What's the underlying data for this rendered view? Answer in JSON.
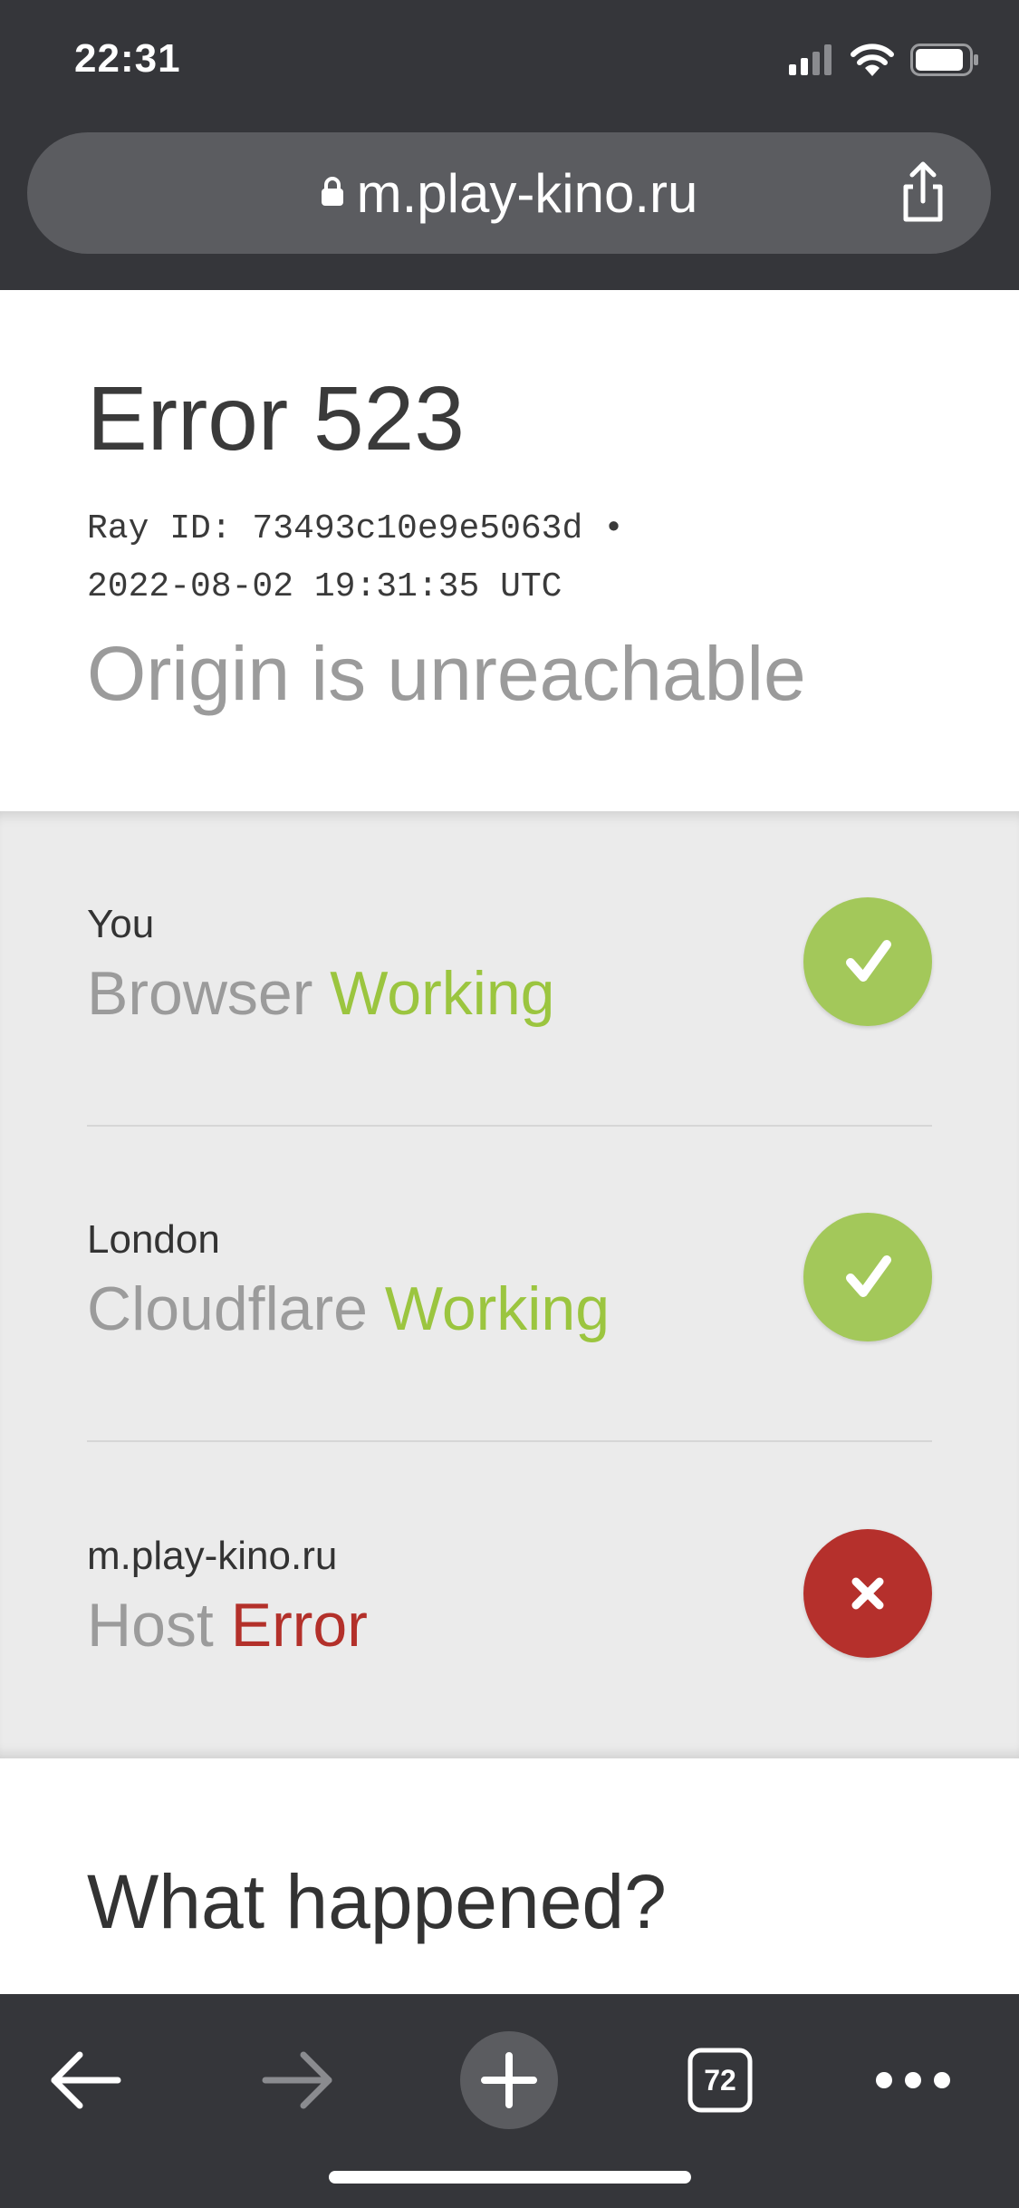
{
  "status_bar": {
    "time": "22:31"
  },
  "browser": {
    "url": "m.play-kino.ru",
    "tab_count": "72"
  },
  "page": {
    "title": "Error 523",
    "ray_line1": "Ray ID: 73493c10e9e5063d •",
    "ray_line2": "2022-08-02 19:31:35 UTC",
    "subtitle": "Origin is unreachable",
    "rows": [
      {
        "location": "You",
        "name": "Browser",
        "status": "Working"
      },
      {
        "location": "London",
        "name": "Cloudflare",
        "status": "Working"
      },
      {
        "location": "m.play-kino.ru",
        "name": "Host",
        "status": "Error"
      }
    ],
    "what_happened": "What happened?"
  },
  "colors": {
    "working": "#9bc53f",
    "error": "#b3302a",
    "chrome": "#35363a"
  }
}
